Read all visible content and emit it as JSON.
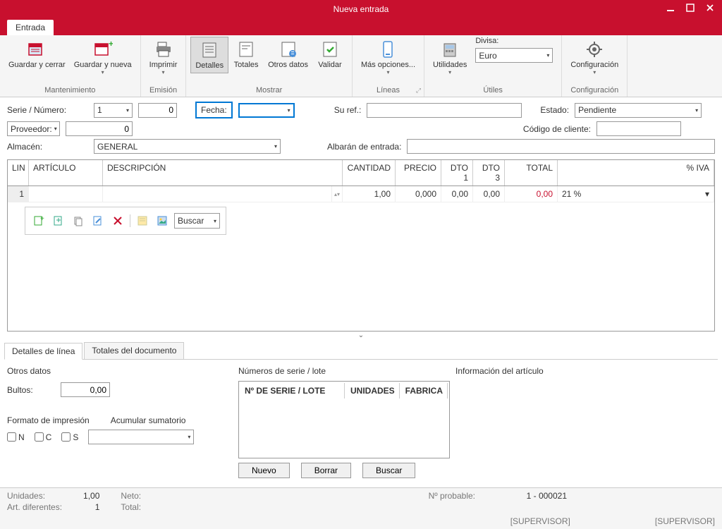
{
  "window": {
    "title": "Nueva entrada"
  },
  "tabs": {
    "entrada": "Entrada"
  },
  "ribbon": {
    "mantenimiento": {
      "label": "Mantenimiento",
      "guardar_cerrar": "Guardar y cerrar",
      "guardar_nueva": "Guardar y nueva"
    },
    "emision": {
      "label": "Emisión",
      "imprimir": "Imprimir"
    },
    "mostrar": {
      "label": "Mostrar",
      "detalles": "Detalles",
      "totales": "Totales",
      "otros_datos": "Otros datos",
      "validar": "Validar"
    },
    "lineas": {
      "label": "Líneas",
      "mas_opciones": "Más opciones..."
    },
    "utiles": {
      "label": "Útiles",
      "utilidades": "Utilidades",
      "divisa_label": "Divisa:",
      "divisa_value": "Euro"
    },
    "configuracion": {
      "label": "Configuración",
      "configuracion": "Configuración"
    }
  },
  "form": {
    "serie_numero_label": "Serie / Número:",
    "serie_value": "1",
    "numero_value": "0",
    "fecha_label": "Fecha:",
    "fecha_value": "",
    "su_ref_label": "Su ref.:",
    "su_ref_value": "",
    "estado_label": "Estado:",
    "estado_value": "Pendiente",
    "proveedor_label": "Proveedor:",
    "proveedor_value": "0",
    "codigo_cliente_label": "Código de cliente:",
    "codigo_cliente_value": "",
    "almacen_label": "Almacén:",
    "almacen_value": "GENERAL",
    "albaran_label": "Albarán de entrada:",
    "albaran_value": ""
  },
  "grid": {
    "headers": {
      "lin": "LIN",
      "articulo": "ARTÍCULO",
      "descripcion": "DESCRIPCIÓN",
      "cantidad": "CANTIDAD",
      "precio": "PRECIO",
      "dto1": "DTO 1",
      "dto3": "DTO 3",
      "total": "TOTAL",
      "iva_pct": "% IVA"
    },
    "rows": [
      {
        "lin": "1",
        "articulo": "",
        "descripcion": "",
        "cantidad": "1,00",
        "precio": "0,000",
        "dto1": "0,00",
        "dto3": "0,00",
        "total": "0,00",
        "iva": "21 %"
      }
    ],
    "toolbar": {
      "buscar": "Buscar"
    }
  },
  "subtabs": {
    "detalles_linea": "Detalles de línea",
    "totales_documento": "Totales del documento"
  },
  "panel_otros": {
    "title": "Otros datos",
    "bultos_label": "Bultos:",
    "bultos_value": "0,00",
    "formato_label": "Formato de impresión",
    "chk_n": "N",
    "chk_c": "C",
    "chk_s": "S",
    "acumular_label": "Acumular sumatorio"
  },
  "panel_serial": {
    "title": "Números de serie / lote",
    "col_serie": "Nº DE SERIE / LOTE",
    "col_unidades": "UNIDADES",
    "col_fabrica": "FABRICA",
    "btn_nuevo": "Nuevo",
    "btn_borrar": "Borrar",
    "btn_buscar": "Buscar"
  },
  "panel_info": {
    "title": "Información del artículo"
  },
  "status": {
    "unidades_label": "Unidades:",
    "unidades_value": "1,00",
    "neto_label": "Neto:",
    "art_dif_label": "Art. diferentes:",
    "art_dif_value": "1",
    "total_label": "Total:",
    "probable_label": "Nº probable:",
    "probable_value": "1 - 000021",
    "supervisor1": "[SUPERVISOR]",
    "supervisor2": "[SUPERVISOR]"
  }
}
